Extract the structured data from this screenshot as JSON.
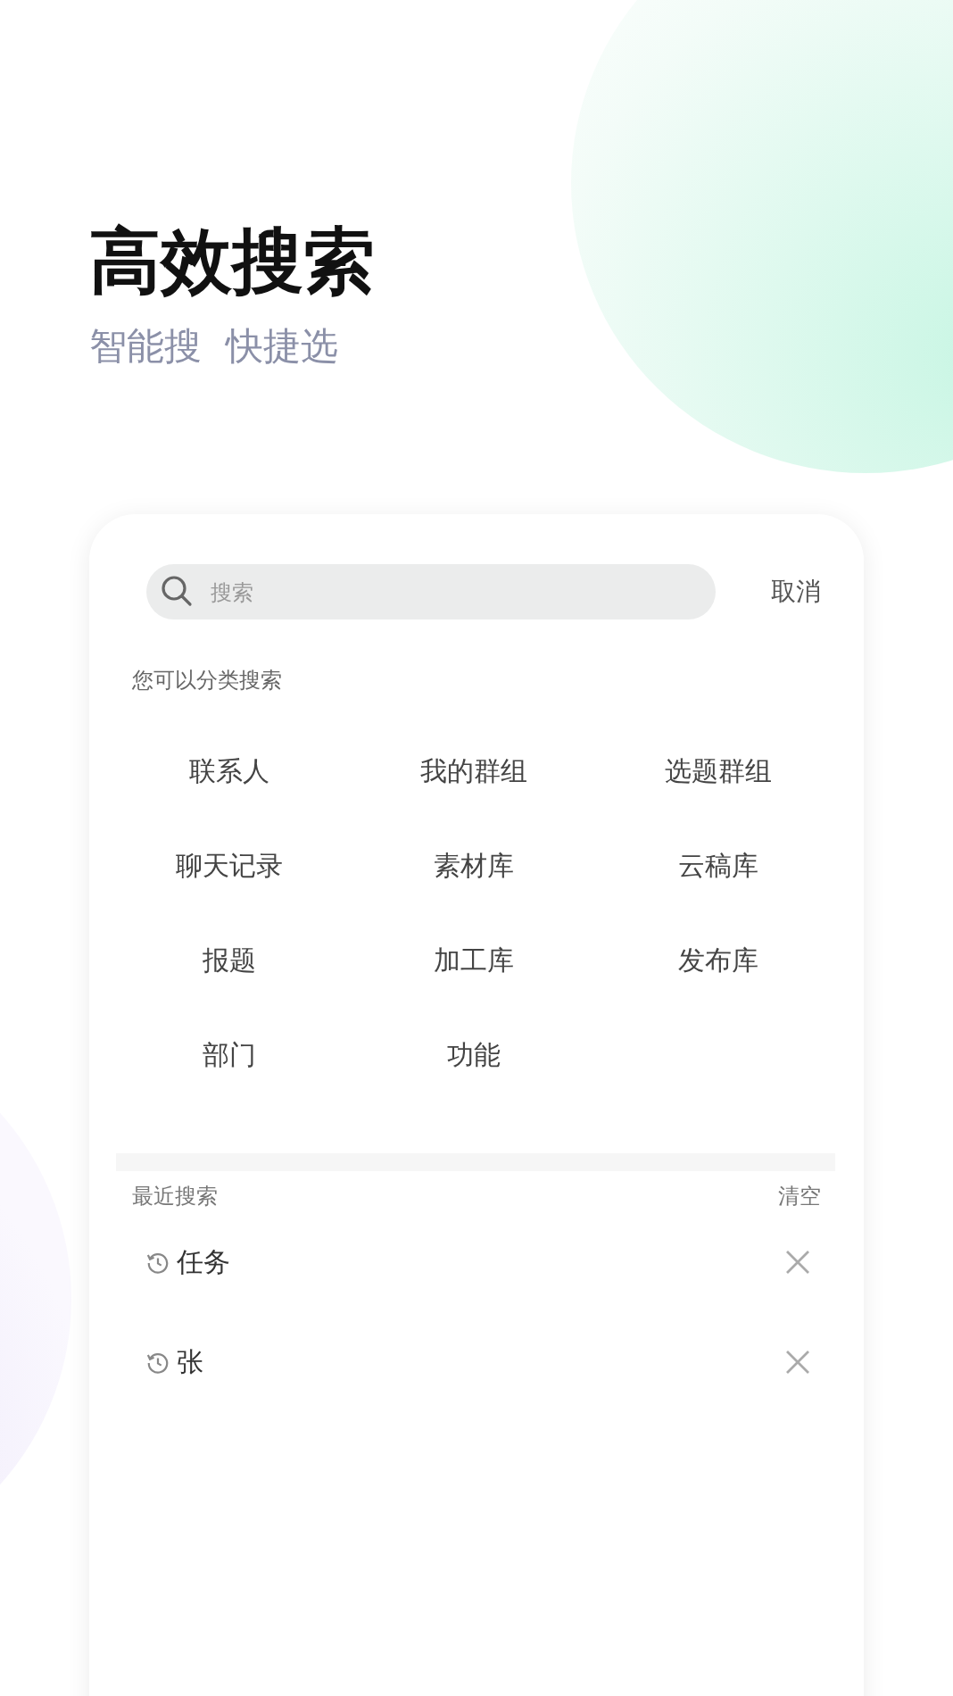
{
  "headline": "高效搜索",
  "subtitle": "智能搜  快捷选",
  "search": {
    "placeholder": "搜索",
    "cancel": "取消"
  },
  "categories": {
    "label": "您可以分类搜索",
    "items": [
      "联系人",
      "我的群组",
      "选题群组",
      "聊天记录",
      "素材库",
      "云稿库",
      "报题",
      "加工库",
      "发布库",
      "部门",
      "功能"
    ]
  },
  "recent": {
    "label": "最近搜索",
    "clear": "清空",
    "items": [
      "任务",
      "张"
    ]
  }
}
